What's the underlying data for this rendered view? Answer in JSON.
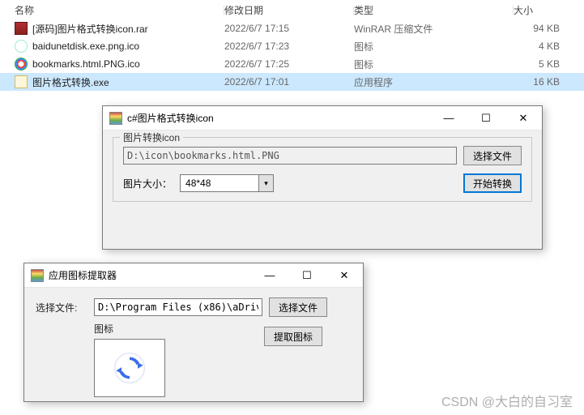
{
  "explorer": {
    "headers": {
      "name": "名称",
      "date": "修改日期",
      "type": "类型",
      "size": "大小"
    },
    "rows": [
      {
        "name": "[源码]图片格式转换icon.rar",
        "date": "2022/6/7 17:15",
        "type": "WinRAR 压缩文件",
        "size": "94 KB",
        "icon": "rar"
      },
      {
        "name": "baidunetdisk.exe.png.ico",
        "date": "2022/6/7 17:23",
        "type": "图标",
        "size": "4 KB",
        "icon": "ico1"
      },
      {
        "name": "bookmarks.html.PNG.ico",
        "date": "2022/6/7 17:25",
        "type": "图标",
        "size": "5 KB",
        "icon": "ico2"
      },
      {
        "name": "图片格式转换.exe",
        "date": "2022/6/7 17:01",
        "type": "应用程序",
        "size": "16 KB",
        "icon": "exe",
        "selected": true
      }
    ]
  },
  "win1": {
    "title": "c#图片格式转换icon",
    "group_title": "图片转换icon",
    "path": "D:\\icon\\bookmarks.html.PNG",
    "browse": "选择文件",
    "size_label": "图片大小：",
    "size_value": "48*48",
    "start": "开始转换",
    "min": "—",
    "max": "☐",
    "close": "✕"
  },
  "win2": {
    "title": "应用图标提取器",
    "file_label": "选择文件:",
    "path": "D:\\Program Files (x86)\\aDrive\\aDr",
    "browse": "选择文件",
    "icon_label": "图标",
    "extract": "提取图标",
    "min": "—",
    "max": "☐",
    "close": "✕"
  },
  "watermark": "CSDN @大白的自习室"
}
